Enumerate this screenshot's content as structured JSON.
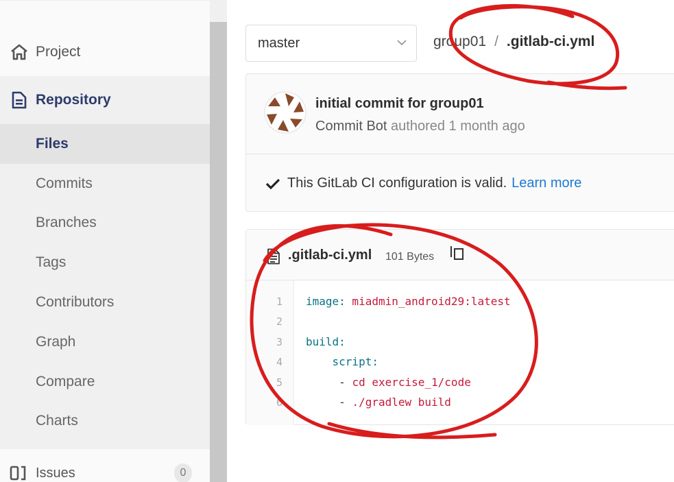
{
  "sidebar": {
    "project_label": "Project",
    "repository_label": "Repository",
    "items": [
      {
        "label": "Files"
      },
      {
        "label": "Commits"
      },
      {
        "label": "Branches"
      },
      {
        "label": "Tags"
      },
      {
        "label": "Contributors"
      },
      {
        "label": "Graph"
      },
      {
        "label": "Compare"
      },
      {
        "label": "Charts"
      }
    ],
    "active_item": "Files",
    "issues_label": "Issues",
    "issues_count": "0"
  },
  "toolbar": {
    "branch": "master",
    "breadcrumb": {
      "group": "group01",
      "separator": "/",
      "file": ".gitlab-ci.yml"
    }
  },
  "commit": {
    "title": "initial commit for group01",
    "author": "Commit Bot",
    "meta": "authored 1 month ago"
  },
  "ci": {
    "status_text": "This GitLab CI configuration is valid.",
    "learn_more": "Learn more"
  },
  "file": {
    "name": ".gitlab-ci.yml",
    "size": "101 Bytes",
    "lines": [
      {
        "no": "1",
        "key": "image:",
        "value": " miadmin_android29:latest",
        "indent": ""
      },
      {
        "no": "2",
        "key": "",
        "value": "",
        "indent": ""
      },
      {
        "no": "3",
        "key": "build:",
        "value": "",
        "indent": ""
      },
      {
        "no": "4",
        "key": "script:",
        "value": "",
        "indent": "    "
      },
      {
        "no": "5",
        "key": "",
        "dash": "- ",
        "value": "cd exercise_1/code",
        "indent": "     "
      },
      {
        "no": "6",
        "key": "",
        "dash": "- ",
        "value": "./gradlew build",
        "indent": "     "
      }
    ]
  },
  "colors": {
    "link": "#1f78d1",
    "nav_active": "#2d3b6b",
    "yaml_key": "#0b7285",
    "yaml_value": "#c41a3a",
    "annotation": "#d81d1d"
  }
}
